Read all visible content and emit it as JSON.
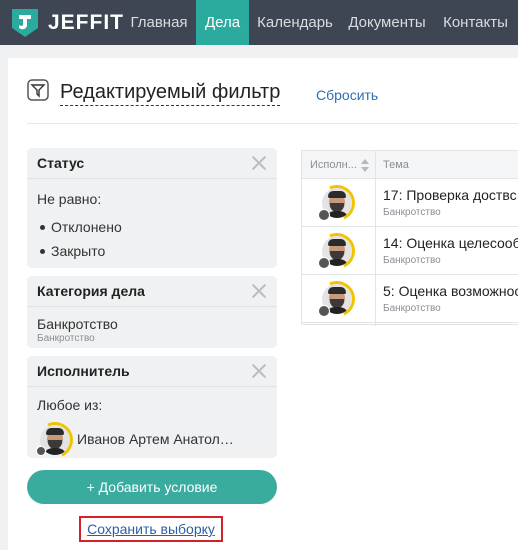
{
  "app": {
    "logo": "JEFFIT"
  },
  "nav": [
    {
      "label": "Главная",
      "active": false
    },
    {
      "label": "Дела",
      "active": true
    },
    {
      "label": "Календарь",
      "active": false
    },
    {
      "label": "Документы",
      "active": false
    },
    {
      "label": "Контакты",
      "active": false
    }
  ],
  "filter": {
    "title": "Редактируемый фильтр",
    "reset": "Сбросить"
  },
  "conditions": {
    "status": {
      "title": "Статус",
      "op": "Не равно:",
      "values": [
        "Отклонено",
        "Закрыто"
      ]
    },
    "category": {
      "title": "Категория дела",
      "value": "Банкротство",
      "sub": "Банкротство"
    },
    "assignee": {
      "title": "Исполнитель",
      "op": "Любое из:",
      "user": "Иванов Артем Анатол…"
    }
  },
  "buttons": {
    "add": "+ Добавить условие",
    "save": "Сохранить выборку"
  },
  "table": {
    "headers": {
      "assignee": "Исполн...",
      "subject": "Тема"
    },
    "rows": [
      {
        "title": "17: Проверка доствс",
        "sub": "Банкротство"
      },
      {
        "title": "14: Оценка целесооб",
        "sub": "Банкротство"
      },
      {
        "title": "5: Оценка возможнос",
        "sub": "Банкротство"
      }
    ]
  },
  "colors": {
    "nav_bg": "#3d4652",
    "accent": "#2aab9e",
    "highlight": "#d3202a",
    "link": "#2f6fb0"
  },
  "icons": [
    "logo-icon",
    "filter-icon",
    "close-icon",
    "sort-icon",
    "plus-icon"
  ]
}
